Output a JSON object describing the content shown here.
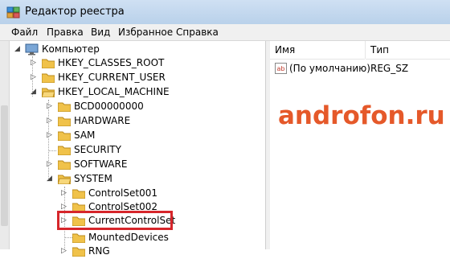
{
  "window": {
    "title": "Редактор реестра"
  },
  "menu": [
    "Файл",
    "Правка",
    "Вид",
    "Избранное",
    "Справка"
  ],
  "tree": {
    "root": "Компьютер",
    "hives": [
      "HKEY_CLASSES_ROOT",
      "HKEY_CURRENT_USER",
      "HKEY_LOCAL_MACHINE"
    ],
    "hklm_children": [
      "BCD00000000",
      "HARDWARE",
      "SAM",
      "SECURITY",
      "SOFTWARE",
      "SYSTEM"
    ],
    "system_children": [
      "ControlSet001",
      "ControlSet002",
      "CurrentControlSet",
      "MountedDevices",
      "RNG"
    ]
  },
  "list": {
    "columns": [
      "Имя",
      "Тип"
    ],
    "rows": [
      {
        "name": "(По умолчанию)",
        "type": "REG_SZ",
        "icon": "reg-string-icon"
      }
    ]
  },
  "watermark": "androfon.ru",
  "colors": {
    "highlight": "#d6262b",
    "watermark": "#e5592a",
    "folder": "#f0c24a"
  }
}
